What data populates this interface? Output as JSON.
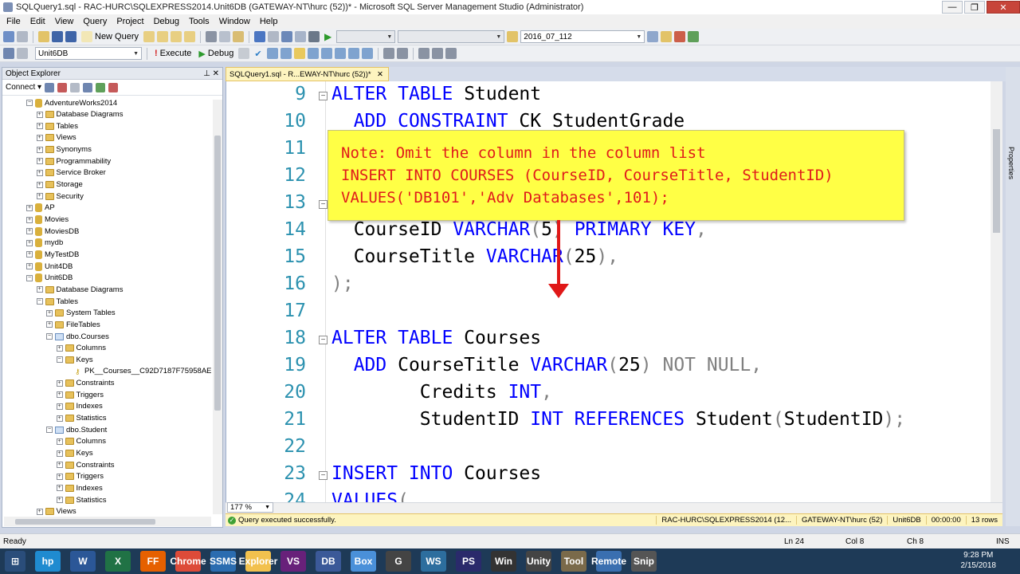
{
  "window": {
    "title": "SQLQuery1.sql - RAC-HURC\\SQLEXPRESS2014.Unit6DB (GATEWAY-NT\\hurc (52))* - Microsoft SQL Server Management Studio (Administrator)",
    "minimize": "—",
    "restore": "❐",
    "close": "✕"
  },
  "menu": [
    "File",
    "Edit",
    "View",
    "Query",
    "Project",
    "Debug",
    "Tools",
    "Window",
    "Help"
  ],
  "toolbar1": {
    "new_query_label": "New Query",
    "solution_combo": "2016_07_112"
  },
  "toolbar2": {
    "database_combo": "Unit6DB",
    "execute_label": "Execute",
    "debug_label": "Debug"
  },
  "object_explorer": {
    "title": "Object Explorer",
    "pin": "⊥ ✕",
    "connect_label": "Connect ▾",
    "tree": [
      {
        "label": "AdventureWorks2014",
        "depth": 2,
        "expanded": true,
        "icon": "database-icon"
      },
      {
        "label": "Database Diagrams",
        "depth": 3,
        "expanded": false,
        "icon": "folder-icon"
      },
      {
        "label": "Tables",
        "depth": 3,
        "expanded": false,
        "icon": "folder-icon"
      },
      {
        "label": "Views",
        "depth": 3,
        "expanded": false,
        "icon": "folder-icon"
      },
      {
        "label": "Synonyms",
        "depth": 3,
        "expanded": false,
        "icon": "folder-icon"
      },
      {
        "label": "Programmability",
        "depth": 3,
        "expanded": false,
        "icon": "folder-icon"
      },
      {
        "label": "Service Broker",
        "depth": 3,
        "expanded": false,
        "icon": "folder-icon"
      },
      {
        "label": "Storage",
        "depth": 3,
        "expanded": false,
        "icon": "folder-icon"
      },
      {
        "label": "Security",
        "depth": 3,
        "expanded": false,
        "icon": "folder-icon"
      },
      {
        "label": "AP",
        "depth": 2,
        "expanded": false,
        "icon": "database-icon"
      },
      {
        "label": "Movies",
        "depth": 2,
        "expanded": false,
        "icon": "database-icon"
      },
      {
        "label": "MoviesDB",
        "depth": 2,
        "expanded": false,
        "icon": "database-icon"
      },
      {
        "label": "mydb",
        "depth": 2,
        "expanded": false,
        "icon": "database-icon"
      },
      {
        "label": "MyTestDB",
        "depth": 2,
        "expanded": false,
        "icon": "database-icon"
      },
      {
        "label": "Unit4DB",
        "depth": 2,
        "expanded": false,
        "icon": "database-icon"
      },
      {
        "label": "Unit6DB",
        "depth": 2,
        "expanded": true,
        "icon": "database-icon"
      },
      {
        "label": "Database Diagrams",
        "depth": 3,
        "expanded": false,
        "icon": "folder-icon"
      },
      {
        "label": "Tables",
        "depth": 3,
        "expanded": true,
        "icon": "folder-icon"
      },
      {
        "label": "System Tables",
        "depth": 4,
        "expanded": false,
        "icon": "folder-icon"
      },
      {
        "label": "FileTables",
        "depth": 4,
        "expanded": false,
        "icon": "folder-icon"
      },
      {
        "label": "dbo.Courses",
        "depth": 4,
        "expanded": true,
        "icon": "table-icon"
      },
      {
        "label": "Columns",
        "depth": 5,
        "expanded": false,
        "icon": "folder-icon"
      },
      {
        "label": "Keys",
        "depth": 5,
        "expanded": true,
        "icon": "folder-icon"
      },
      {
        "label": "PK__Courses__C92D7187F75958AE",
        "depth": 6,
        "expanded": null,
        "icon": "key-icon"
      },
      {
        "label": "Constraints",
        "depth": 5,
        "expanded": false,
        "icon": "folder-icon"
      },
      {
        "label": "Triggers",
        "depth": 5,
        "expanded": false,
        "icon": "folder-icon"
      },
      {
        "label": "Indexes",
        "depth": 5,
        "expanded": false,
        "icon": "folder-icon"
      },
      {
        "label": "Statistics",
        "depth": 5,
        "expanded": false,
        "icon": "folder-icon"
      },
      {
        "label": "dbo.Student",
        "depth": 4,
        "expanded": true,
        "icon": "table-icon"
      },
      {
        "label": "Columns",
        "depth": 5,
        "expanded": false,
        "icon": "folder-icon"
      },
      {
        "label": "Keys",
        "depth": 5,
        "expanded": false,
        "icon": "folder-icon"
      },
      {
        "label": "Constraints",
        "depth": 5,
        "expanded": false,
        "icon": "folder-icon"
      },
      {
        "label": "Triggers",
        "depth": 5,
        "expanded": false,
        "icon": "folder-icon"
      },
      {
        "label": "Indexes",
        "depth": 5,
        "expanded": false,
        "icon": "folder-icon"
      },
      {
        "label": "Statistics",
        "depth": 5,
        "expanded": false,
        "icon": "folder-icon"
      },
      {
        "label": "Views",
        "depth": 3,
        "expanded": false,
        "icon": "folder-icon"
      }
    ]
  },
  "editor": {
    "tab_label": "SQLQuery1.sql - R...EWAY-NT\\hurc (52))*",
    "tab_close": "✕",
    "zoom": "177 %",
    "lines": [
      {
        "num": "9",
        "fold": true,
        "segs": [
          [
            "kw",
            "ALTER"
          ],
          [
            "",
            ""
          ],
          [
            "kw",
            " TABLE"
          ],
          [
            "",
            " Student"
          ]
        ]
      },
      {
        "num": "10",
        "fold": false,
        "segs": [
          [
            "",
            "  "
          ],
          [
            "kw",
            "ADD CONSTRAINT"
          ],
          [
            "",
            " CK_StudentGrade"
          ]
        ]
      },
      {
        "num": "11",
        "fold": false,
        "segs": []
      },
      {
        "num": "12",
        "fold": false,
        "segs": []
      },
      {
        "num": "13",
        "fold": true,
        "segs": []
      },
      {
        "num": "14",
        "fold": false,
        "segs": [
          [
            "",
            "  CourseID "
          ],
          [
            "kw",
            "VARCHAR"
          ],
          [
            "gr",
            "("
          ],
          [
            "",
            "5"
          ],
          [
            "gr",
            ")"
          ],
          [
            "kw",
            " PRIMARY KEY"
          ],
          [
            "gr",
            ","
          ]
        ]
      },
      {
        "num": "15",
        "fold": false,
        "segs": [
          [
            "",
            "  CourseTitle "
          ],
          [
            "kw",
            "VARCHAR"
          ],
          [
            "gr",
            "("
          ],
          [
            "",
            "25"
          ],
          [
            "gr",
            "),"
          ]
        ]
      },
      {
        "num": "16",
        "fold": false,
        "segs": [
          [
            "gr",
            ");"
          ]
        ]
      },
      {
        "num": "17",
        "fold": false,
        "segs": []
      },
      {
        "num": "18",
        "fold": true,
        "segs": [
          [
            "kw",
            "ALTER TABLE"
          ],
          [
            "",
            " Courses"
          ]
        ]
      },
      {
        "num": "19",
        "fold": false,
        "segs": [
          [
            "",
            "  "
          ],
          [
            "kw",
            "ADD"
          ],
          [
            "",
            " CourseTitle "
          ],
          [
            "kw",
            "VARCHAR"
          ],
          [
            "gr",
            "("
          ],
          [
            "",
            "25"
          ],
          [
            "gr",
            ")"
          ],
          [
            "gr",
            " NOT NULL,"
          ]
        ]
      },
      {
        "num": "20",
        "fold": false,
        "segs": [
          [
            "",
            "        Credits "
          ],
          [
            "kw",
            "INT"
          ],
          [
            "gr",
            ","
          ]
        ]
      },
      {
        "num": "21",
        "fold": false,
        "segs": [
          [
            "",
            "        StudentID "
          ],
          [
            "kw",
            "INT REFERENCES"
          ],
          [
            "",
            " Student"
          ],
          [
            "gr",
            "("
          ],
          [
            "",
            "StudentID"
          ],
          [
            "gr",
            ");"
          ]
        ]
      },
      {
        "num": "22",
        "fold": false,
        "segs": []
      },
      {
        "num": "23",
        "fold": true,
        "segs": [
          [
            "kw",
            "INSERT INTO"
          ],
          [
            "",
            " Courses"
          ]
        ]
      },
      {
        "num": "24",
        "fold": false,
        "segs": [
          [
            "kw",
            "VALUES"
          ],
          [
            "gr",
            "("
          ]
        ]
      }
    ]
  },
  "note": {
    "line1": "Note: Omit the column in the column list",
    "line2": "INSERT INTO COURSES (CourseID, CourseTitle, StudentID)",
    "line3": "VALUES('DB101','Adv Databases',101);"
  },
  "query_status": {
    "message": "Query executed successfully.",
    "server": "RAC-HURC\\SQLEXPRESS2014 (12...",
    "user": "GATEWAY-NT\\hurc (52)",
    "database": "Unit6DB",
    "elapsed": "00:00:00",
    "rows": "13 rows"
  },
  "properties_tab": "Properties",
  "statusbar": {
    "ready": "Ready",
    "ln": "Ln 24",
    "col": "Col 8",
    "ch": "Ch 8",
    "ins": "INS"
  },
  "taskbar": {
    "time": "9:28 PM",
    "date": "2/15/2018",
    "apps": [
      "hp",
      "W",
      "X",
      "FF",
      "Chrome",
      "SSMS",
      "Explorer",
      "VS",
      "DB",
      "Box",
      "G",
      "WS",
      "PS",
      "Win",
      "Unity",
      "Tool",
      "Remote",
      "Snip"
    ]
  }
}
